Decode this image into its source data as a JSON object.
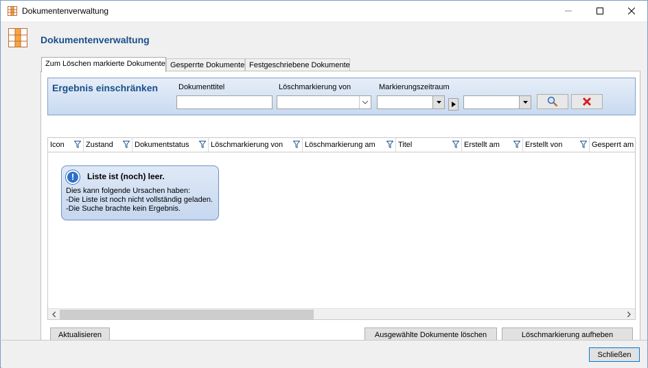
{
  "window": {
    "title": "Dokumentenverwaltung"
  },
  "page": {
    "title": "Dokumentenverwaltung"
  },
  "tabs": [
    {
      "label": "Zum Löschen markierte Dokumente",
      "active": true
    },
    {
      "label": "Gesperrte Dokumente",
      "active": false
    },
    {
      "label": "Festgeschriebene Dokumente",
      "active": false
    }
  ],
  "filter": {
    "title": "Ergebnis einschränken",
    "doc_title_label": "Dokumenttitel",
    "doc_title_value": "",
    "marked_by_label": "Löschmarkierung von",
    "marked_by_value": "",
    "period_label": "Markierungszeitraum",
    "period_from": "",
    "period_to": ""
  },
  "grid": {
    "columns": [
      "Icon",
      "Zustand",
      "Dokumentstatus",
      "Löschmarkierung von",
      "Löschmarkierung am",
      "Titel",
      "Erstellt am",
      "Erstellt von",
      "Gesperrt am"
    ],
    "rows": []
  },
  "empty_message": {
    "title": "Liste ist (noch) leer.",
    "lines": [
      "Dies kann folgende Ursachen haben:",
      "-Die Liste ist noch nicht vollständig geladen.",
      "-Die Suche brachte kein Ergebnis."
    ]
  },
  "buttons": {
    "refresh": "Aktualisieren",
    "delete_selected": "Ausgewählte Dokumente löschen",
    "remove_mark": "Löschmarkierung aufheben",
    "close": "Schließen"
  },
  "icons": {
    "app": "app-grid-icon",
    "search": "search-icon",
    "clear": "clear-filter-icon",
    "info": "info-icon"
  },
  "colors": {
    "accent": "#1a4e8a",
    "clear_red": "#d42020"
  }
}
